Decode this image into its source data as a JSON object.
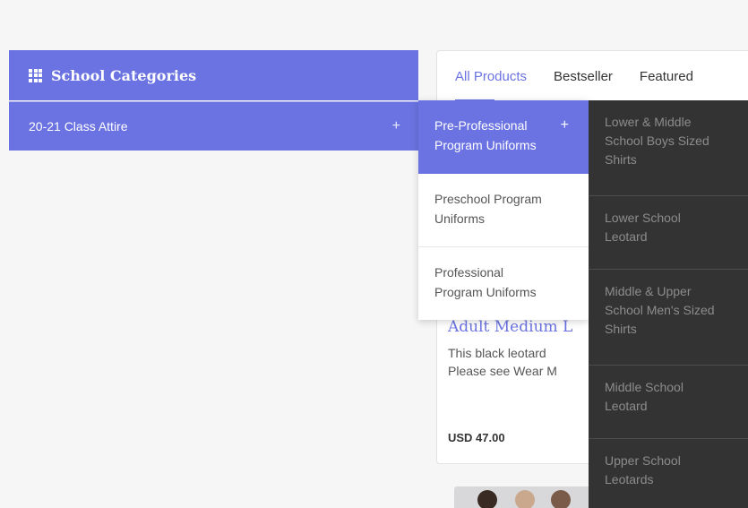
{
  "sidebar": {
    "header": "School Categories",
    "header_icon": "grid-icon",
    "items": [
      {
        "label": "20-21 Class Attire",
        "expand": "+"
      }
    ]
  },
  "submenu": {
    "items": [
      {
        "label_line1": "Pre-Professional",
        "label_line2": "Program Uniforms",
        "expand": "+",
        "active": true
      },
      {
        "label_line1": "Preschool Program",
        "label_line2": "Uniforms",
        "active": false
      },
      {
        "label_line1": "Professional",
        "label_line2": "Program Uniforms",
        "active": false
      }
    ]
  },
  "dark_menu": {
    "items": [
      {
        "line1": "Lower & Middle",
        "line2": "School Boys Sized",
        "line3": "Shirts"
      },
      {
        "line1": "Lower School",
        "line2": "Leotard",
        "line3": ""
      },
      {
        "line1": "Middle & Upper",
        "line2": "School Men's Sized",
        "line3": "Shirts"
      },
      {
        "line1": "Middle School",
        "line2": "Leotard",
        "line3": ""
      },
      {
        "line1": "Upper School",
        "line2": "Leotards",
        "line3": ""
      }
    ]
  },
  "products": {
    "tabs": [
      "All Products",
      "Bestseller",
      "Featured"
    ],
    "title": "Adult Medium L",
    "desc_line1": "This black leotard",
    "desc_line2": "Please see Wear M",
    "price": "USD 47.00"
  },
  "colors": {
    "accent": "#6b73e2",
    "dark": "#333333"
  }
}
